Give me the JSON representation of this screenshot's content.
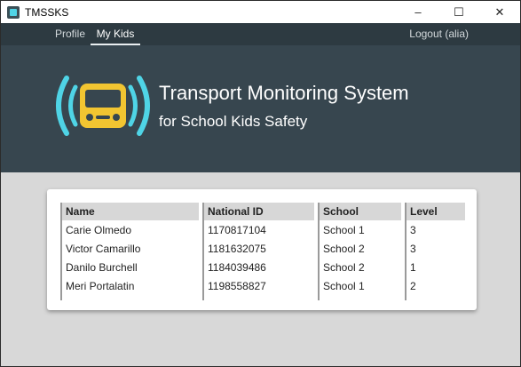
{
  "window": {
    "title": "TMSSKS",
    "controls": {
      "minimize": "–",
      "maximize": "☐",
      "close": "✕"
    }
  },
  "nav": {
    "profile": "Profile",
    "my_kids": "My Kids",
    "logout": "Logout (alia)",
    "active": "My Kids"
  },
  "hero": {
    "title": "Transport Monitoring System",
    "subtitle": "for School Kids Safety",
    "logo_icon": "bus-signal-icon",
    "colors": {
      "logo_signal": "#4fd4e6",
      "logo_bus": "#f2c531",
      "header_bg": "#37464f"
    }
  },
  "table": {
    "columns": [
      "Name",
      "National ID",
      "School",
      "Level"
    ],
    "rows": [
      {
        "name": "Carie Olmedo",
        "national_id": "1170817104",
        "school": "School 1",
        "level": "3"
      },
      {
        "name": "Victor Camarillo",
        "national_id": "1181632075",
        "school": "School 2",
        "level": "3"
      },
      {
        "name": "Danilo Burchell",
        "national_id": "1184039486",
        "school": "School 2",
        "level": "1"
      },
      {
        "name": "Meri Portalatin",
        "national_id": "1198558827",
        "school": "School 1",
        "level": "2"
      }
    ]
  }
}
